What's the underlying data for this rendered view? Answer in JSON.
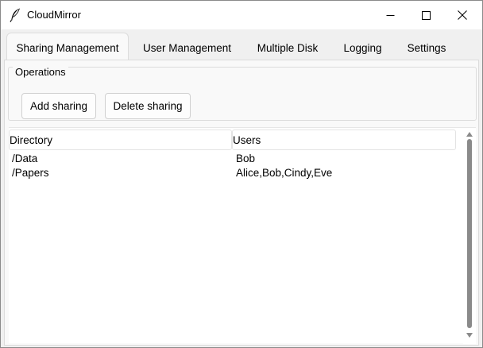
{
  "window": {
    "title": "CloudMirror",
    "icons": {
      "app": "feather-icon",
      "minimize": "minimize-icon",
      "maximize": "maximize-icon",
      "close": "close-icon"
    }
  },
  "tabs": [
    {
      "label": "Sharing Management",
      "active": true
    },
    {
      "label": "User Management",
      "active": false
    },
    {
      "label": "Multiple Disk",
      "active": false
    },
    {
      "label": "Logging",
      "active": false
    },
    {
      "label": "Settings",
      "active": false
    }
  ],
  "operations": {
    "label": "Operations",
    "add_label": "Add sharing",
    "delete_label": "Delete sharing"
  },
  "table": {
    "columns": [
      "Directory",
      "Users"
    ],
    "rows": [
      {
        "directory": "/Data",
        "users": "Bob"
      },
      {
        "directory": "/Papers",
        "users": "Alice,Bob,Cindy,Eve"
      }
    ]
  },
  "colors": {
    "window_bg": "#f0f0f0",
    "panel_bg": "#f9f9f9",
    "scroll_thumb": "#8a8a8a"
  }
}
